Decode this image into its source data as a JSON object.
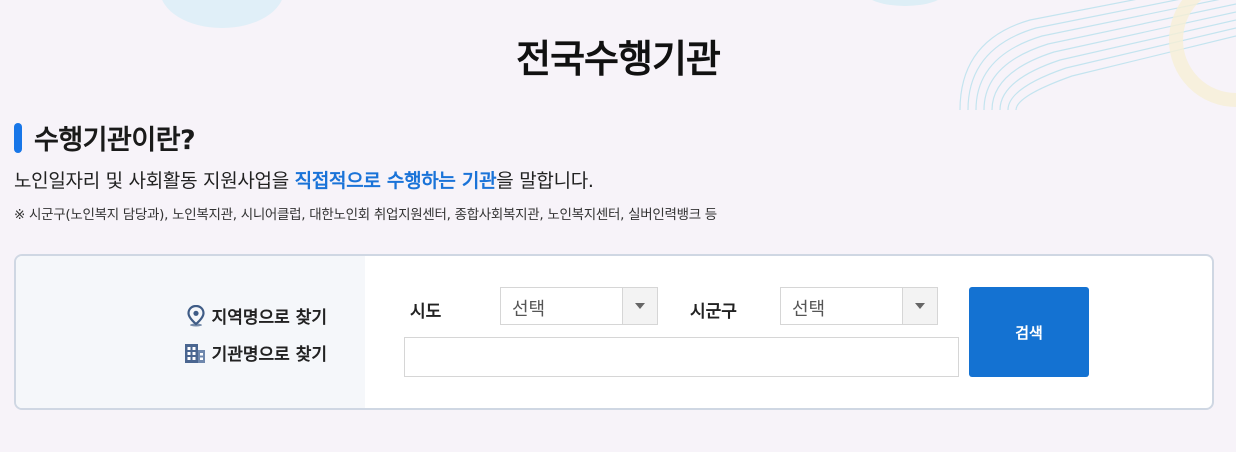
{
  "page": {
    "title": "전국수행기관"
  },
  "section": {
    "title": "수행기관이란?",
    "desc_before": "노인일자리 및 사회활동 지원사업을 ",
    "desc_highlight": "직접적으로 수행하는 기관",
    "desc_after": "을 말합니다.",
    "note": "※ 시군구(노인복지 담당과), 노인복지관, 시니어클럽, 대한노인회 취업지원센터, 종합사회복지관, 노인복지센터, 실버인력뱅크 등"
  },
  "search": {
    "mode_region": "지역명으로 찾기",
    "mode_agency": "기관명으로 찾기",
    "sido_label": "시도",
    "sido_value": "선택",
    "sigungu_label": "시군구",
    "sigungu_value": "선택",
    "keyword_value": "",
    "button_label": "검색"
  },
  "icons": {
    "region": "location-pin-icon",
    "agency": "building-icon",
    "dropdown": "caret-down-icon"
  },
  "colors": {
    "accent": "#1876e8",
    "highlight": "#1a73d8",
    "button": "#1472d2",
    "background": "#f7f3f9"
  }
}
